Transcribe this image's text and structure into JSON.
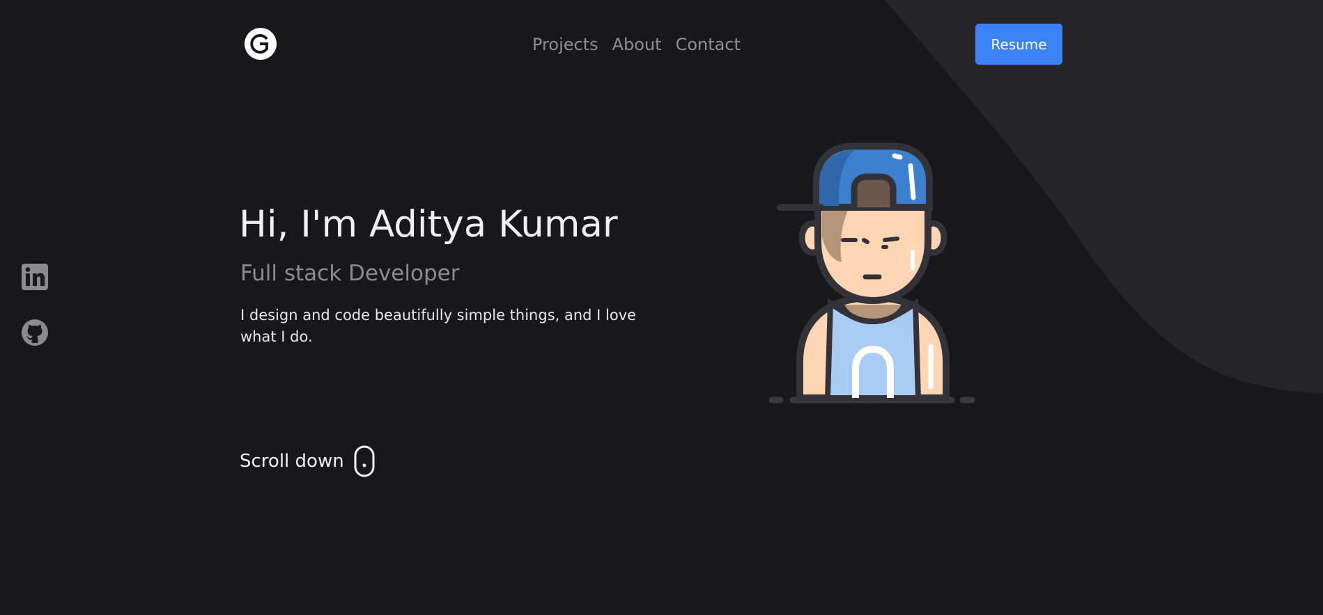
{
  "header": {
    "nav": [
      {
        "label": "Projects"
      },
      {
        "label": "About"
      },
      {
        "label": "Contact"
      }
    ],
    "resume_label": "Resume"
  },
  "social": {
    "icons": [
      "linkedin-icon",
      "github-icon"
    ]
  },
  "hero": {
    "title": "Hi, I'm Aditya Kumar",
    "subtitle": "Full stack Developer",
    "description": "I design and code beautifully simple things, and I love what I do.",
    "scroll_label": "Scroll down"
  },
  "colors": {
    "background": "#18171c",
    "accent_shape": "#252429",
    "primary": "#3b82f6"
  }
}
